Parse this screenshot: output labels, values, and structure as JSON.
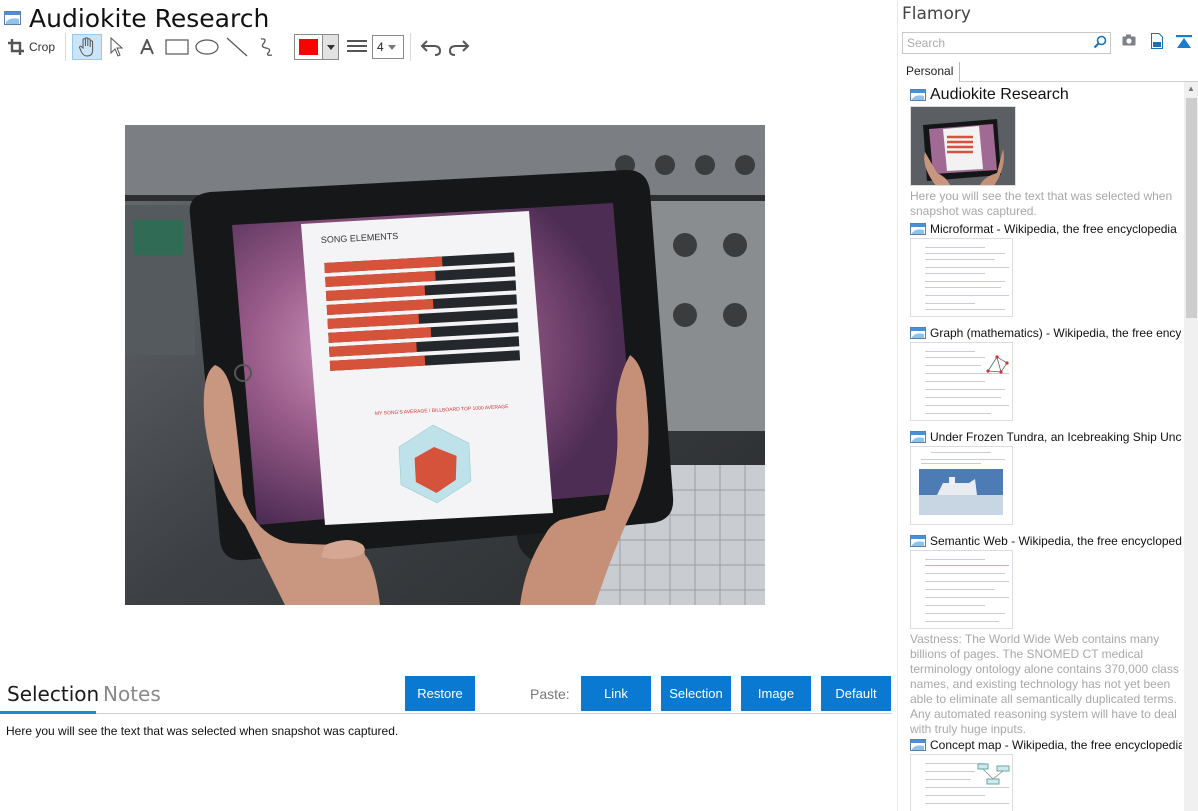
{
  "document": {
    "title": "Audiokite Research"
  },
  "toolbar": {
    "crop_label": "Crop",
    "stroke_color": "#ff0000",
    "line_width": "4"
  },
  "snapshot": {
    "heading": "SONG ELEMENTS",
    "subtitle": "MY SONG'S AVERAGE / BILLBOARD TOP 1000 AVERAGE"
  },
  "bottom": {
    "tabs": [
      "Selection",
      "Notes"
    ],
    "restore_label": "Restore",
    "paste_label": "Paste:",
    "paste_buttons": [
      "Link",
      "Selection",
      "Image",
      "Default"
    ],
    "selection_text": "Here you will see the text that was selected when snapshot was captured."
  },
  "sidebar": {
    "app_title": "Flamory",
    "search_placeholder": "Search",
    "tab_label": "Personal",
    "entries": [
      {
        "title": "Audiokite Research",
        "excerpt": "Here you will see the text that was selected when snapshot was captured."
      },
      {
        "title": "Microformat - Wikipedia, the free encyclopedia"
      },
      {
        "title": "Graph (mathematics) - Wikipedia, the free ency"
      },
      {
        "title": "Under Frozen Tundra, an Icebreaking Ship Unco"
      },
      {
        "title": "Semantic Web - Wikipedia, the free encycloped",
        "excerpt": "Vastness: The World Wide Web contains many billions of pages. The SNOMED CT medical terminology ontology alone contains 370,000 class names, and existing technology has not yet been able to eliminate all semantically duplicated terms. Any automated reasoning system will have to deal with truly huge inputs."
      },
      {
        "title": "Concept map - Wikipedia, the free encyclopedia"
      }
    ]
  }
}
